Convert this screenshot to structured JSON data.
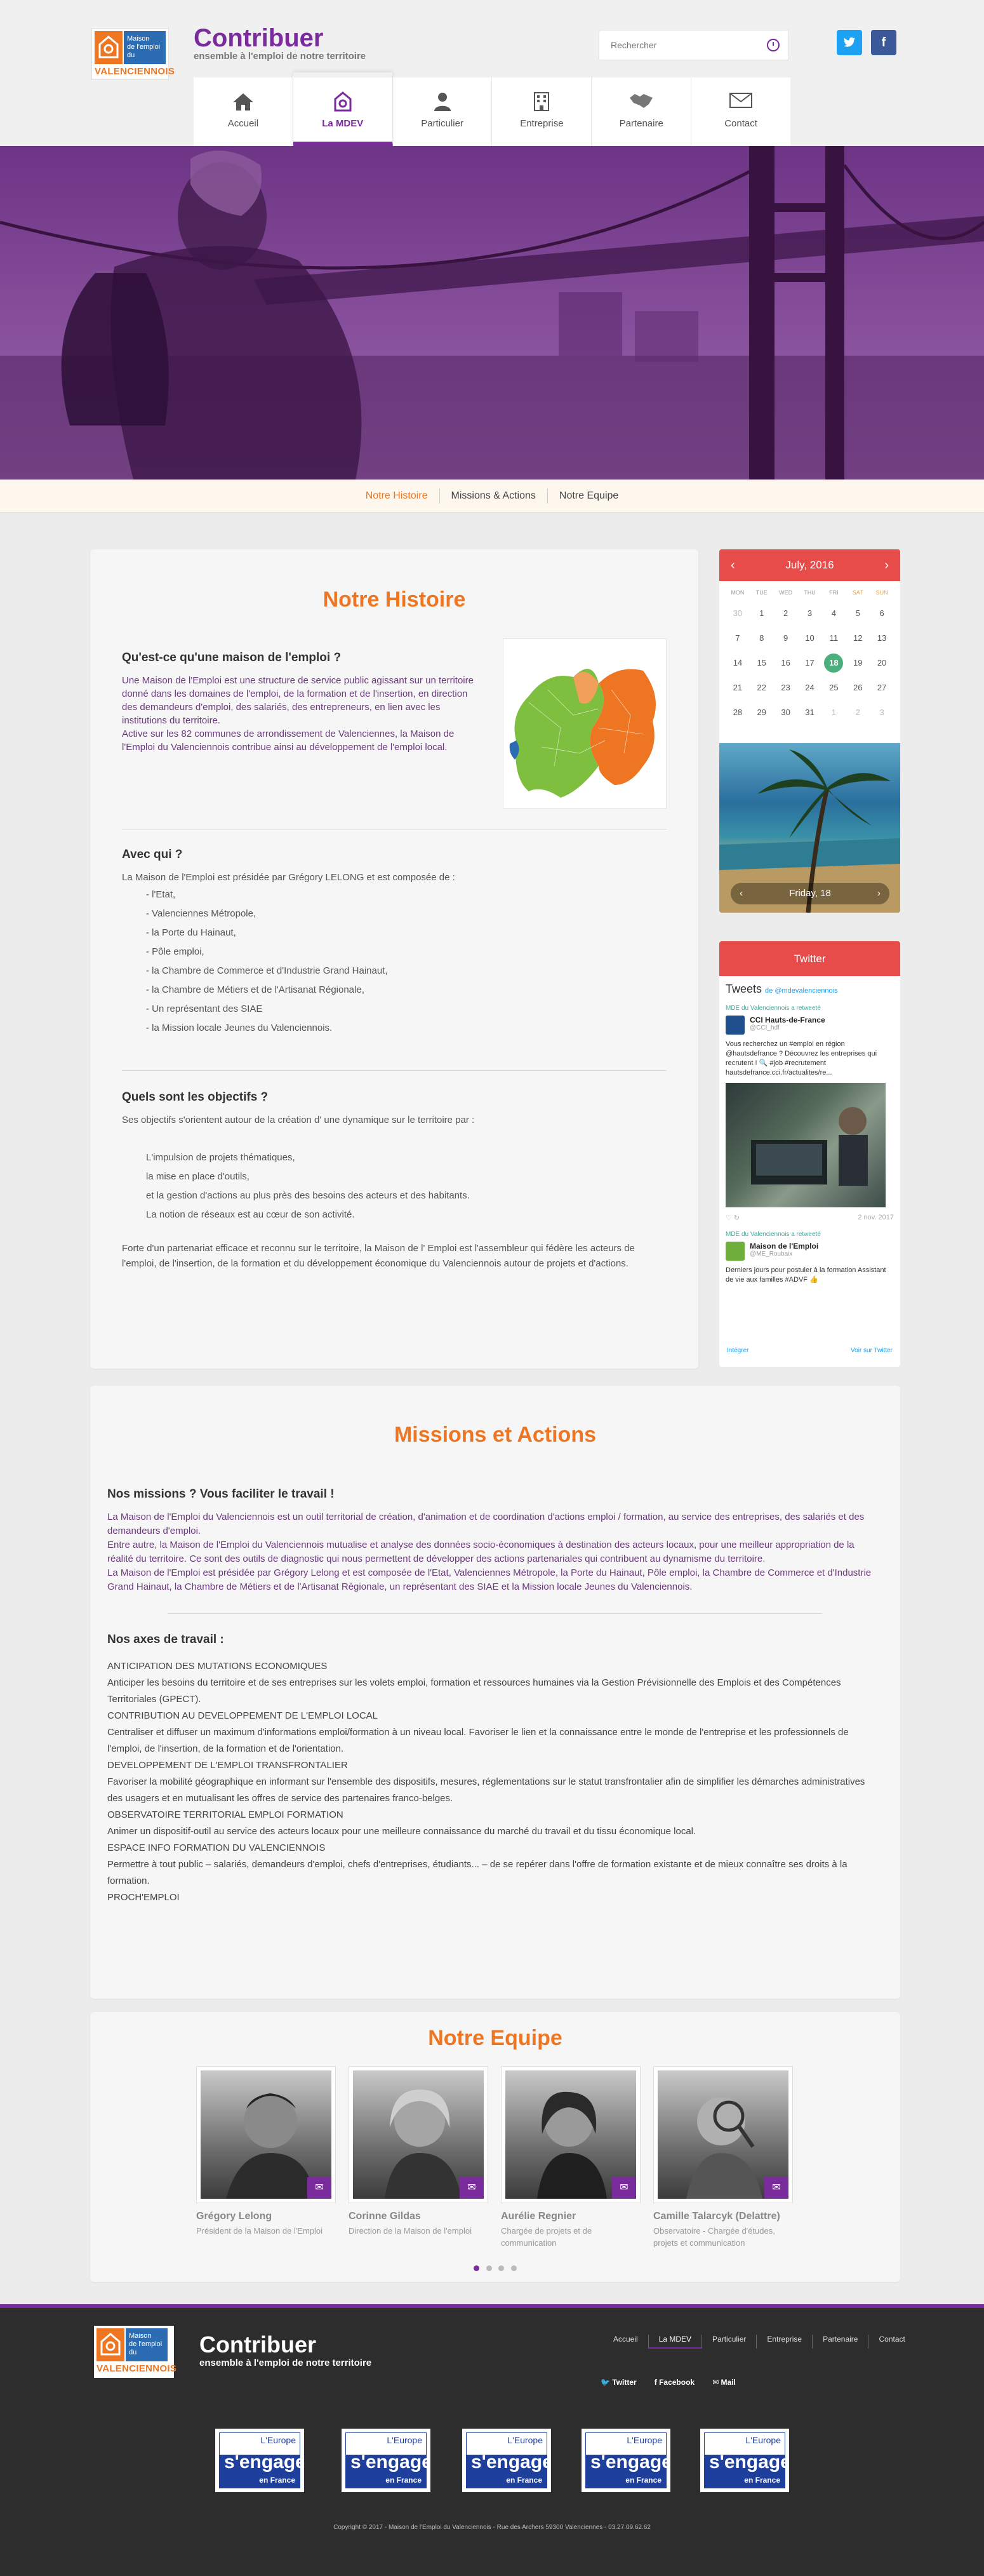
{
  "header": {
    "logo": {
      "line1": "Maison",
      "line2": "de l'emploi",
      "line3": "du",
      "band": "VALENCIENNOIS"
    },
    "brand_title": "Contribuer",
    "brand_subtitle": "ensemble à l'emploi de notre territoire",
    "search_placeholder": "Rechercher",
    "social": {
      "twitter": "t",
      "facebook": "f"
    },
    "nav": [
      {
        "label": "Accueil",
        "icon": "home-icon"
      },
      {
        "label": "La MDEV",
        "icon": "mdev-logo-icon",
        "active": true
      },
      {
        "label": "Particulier",
        "icon": "user-icon"
      },
      {
        "label": "Entreprise",
        "icon": "building-icon"
      },
      {
        "label": "Partenaire",
        "icon": "handshake-icon"
      },
      {
        "label": "Contact",
        "icon": "envelope-icon"
      }
    ]
  },
  "subnav": [
    "Notre Histoire",
    "Missions & Actions",
    "Notre Equipe"
  ],
  "histoire": {
    "title": "Notre Histoire",
    "q1": "Qu'est-ce qu'une maison de l'emploi ?",
    "q1_text": "Une Maison de l'Emploi est une structure de service public agissant sur un territoire donné dans les domaines de l'emploi, de la formation et de l'insertion, en direction des demandeurs d'emploi, des salariés, des entrepreneurs, en lien avec les institutions du territoire.",
    "q1_text2": "Active sur les 82 communes de arrondissement de Valenciennes, la Maison de l'Emploi du Valenciennois contribue ainsi au développement de l'emploi local.",
    "q2": "Avec qui ?",
    "q2_intro": "La Maison de l'Emploi est présidée par Grégory LELONG  et est composée de :",
    "q2_list": [
      "- l'Etat,",
      "- Valenciennes Métropole,",
      "- la Porte du Hainaut,",
      "- Pôle emploi,",
      "- la Chambre de Commerce et d'Industrie Grand Hainaut,",
      "- la Chambre de Métiers et de l'Artisanat Régionale,",
      "- Un représentant des SIAE",
      "- la Mission locale Jeunes du Valenciennois."
    ],
    "q3": "Quels sont les objectifs ?",
    "q3_intro": "Ses objectifs s'orientent autour de la création d' une dynamique sur le territoire par :",
    "q3_list": [
      "L'impulsion de projets thématiques,",
      "la mise en place d'outils,",
      "et la gestion d'actions au plus près des besoins des acteurs et des habitants.",
      "La notion de réseaux est au cœur de son activité."
    ],
    "q3_outro": "Forte d'un partenariat efficace et reconnu sur le territoire, la Maison de l' Emploi est l'assembleur qui fédère les acteurs de l'emploi, de l'insertion, de la formation et du développement économique du Valenciennois autour de projets et d'actions."
  },
  "calendar": {
    "month": "July, 2016",
    "weekdays": [
      "MON",
      "TUE",
      "WED",
      "THU",
      "FRI",
      "SAT",
      "SUN"
    ],
    "days": [
      [
        "30",
        "1",
        "2",
        "3",
        "4",
        "5",
        "6"
      ],
      [
        "7",
        "8",
        "9",
        "10",
        "11",
        "12",
        "13"
      ],
      [
        "14",
        "15",
        "16",
        "17",
        "18",
        "19",
        "20"
      ],
      [
        "21",
        "22",
        "23",
        "24",
        "25",
        "26",
        "27"
      ],
      [
        "28",
        "29",
        "30",
        "31",
        "1",
        "2",
        "3"
      ]
    ],
    "today": "18",
    "footer_label": "Friday, 18"
  },
  "twitter": {
    "header": "Twitter",
    "title": "Tweets",
    "by": "de @mdevalenciennois",
    "retweet1": "MDE du Valenciennois a retweeté",
    "t1_name": "CCI Hauts-de-France",
    "t1_handle": "@CCI_hdf",
    "t1_text": "Vous recherchez un #emploi en région @hautsdefrance ? Découvrez les entreprises qui recrutent ! 🔍 #job #recrutement hautsdefrance.cci.fr/actualites/re...",
    "t1_date": "2 nov. 2017",
    "retweet2": "MDE du Valenciennois a retweeté",
    "t2_name": "Maison de l'Emploi",
    "t2_handle": "@ME_Roubaix",
    "t2_text": "Derniers jours pour postuler à la formation Assistant de vie aux familles #ADVF 👍",
    "embed": "Intégrer",
    "view": "Voir sur Twitter"
  },
  "missions": {
    "title": "Missions et Actions",
    "h1": "Nos missions ? Vous faciliter le travail !",
    "p1": "La Maison de l'Emploi du Valenciennois est un outil territorial de création, d'animation et de coordination d'actions emploi / formation, au service des entreprises, des salariés et des demandeurs d'emploi.",
    "p2": "Entre autre, la Maison de l'Emploi du Valenciennois mutualise et analyse des données socio-économiques à destination des acteurs locaux, pour une meilleur appropriation de la réalité du territoire. Ce sont des outils de diagnostic qui nous permettent de développer des actions partenariales qui contribuent au dynamisme du territoire.",
    "p3": "La Maison de l'Emploi est présidée par Grégory Lelong et est composée de l'Etat, Valenciennes Métropole, la Porte du Hainaut, Pôle emploi, la Chambre de Commerce et d'Industrie Grand Hainaut, la Chambre de Métiers et de l'Artisanat Régionale, un représentant des SIAE et la Mission locale Jeunes du Valenciennois.",
    "h2": "Nos axes de travail :",
    "axes": [
      "ANTICIPATION DES MUTATIONS ECONOMIQUES",
      "Anticiper les besoins du territoire et de ses entreprises sur les volets emploi, formation et ressources humaines via la Gestion Prévisionnelle des Emplois et des Compétences Territoriales (GPECT).",
      "CONTRIBUTION AU DEVELOPPEMENT DE L'EMPLOI LOCAL",
      "Centraliser et diffuser un maximum d'informations emploi/formation à un niveau local. Favoriser le lien et la connaissance entre le monde de l'entreprise et les professionnels de l'emploi, de l'insertion, de la formation et de l'orientation.",
      "DEVELOPPEMENT DE L'EMPLOI TRANSFRONTALIER",
      "Favoriser la mobilité géographique en informant sur l'ensemble des dispositifs, mesures, réglementations sur le statut transfrontalier afin de simplifier les démarches administratives des usagers et en mutualisant les offres de service des partenaires franco-belges.",
      "OBSERVATOIRE TERRITORIAL EMPLOI FORMATION",
      "Animer un dispositif-outil au service des acteurs locaux pour une meilleure connaissance du marché du travail et du tissu économique local.",
      "ESPACE INFO FORMATION DU VALENCIENNOIS",
      "Permettre à tout public – salariés, demandeurs d'emploi, chefs d'entreprises, étudiants... – de se repérer dans l'offre de formation existante et de mieux connaître ses droits à la formation.",
      "PROCH'EMPLOI"
    ]
  },
  "equipe": {
    "title": "Notre Equipe",
    "members": [
      {
        "name": "Grégory Lelong",
        "role": "Président de la Maison de l'Emploi"
      },
      {
        "name": "Corinne Gildas",
        "role": "Direction de la Maison de l'emploi"
      },
      {
        "name": "Aurélie Regnier",
        "role": "Chargée de projets et de communication"
      },
      {
        "name": "Camille Talarcyk (Delattre)",
        "role": "Observatoire - Chargée d'études, projets et communication"
      }
    ]
  },
  "footer": {
    "brand_title": "Contribuer",
    "brand_subtitle": "ensemble à l'emploi de notre territoire",
    "nav": [
      "Accueil",
      "La MDEV",
      "Particulier",
      "Entreprise",
      "Partenaire",
      "Contact"
    ],
    "social": [
      "Twitter",
      "Facebook",
      "Mail"
    ],
    "eu_top": "L'Europe",
    "eu_mid": "s'engage",
    "eu_bot": "en France",
    "copyright": "Copyright © 2017 - Maison de l'Emploi du Valenciennois - Rue des Archers 59300 Valenciennes - 03.27.09.62.62"
  },
  "colors": {
    "brand_purple": "#7a2b9c",
    "accent_orange": "#ee7622",
    "calendar_red": "#e84c4a",
    "twitter_blue": "#1da1f2",
    "facebook_blue": "#3b5998"
  }
}
